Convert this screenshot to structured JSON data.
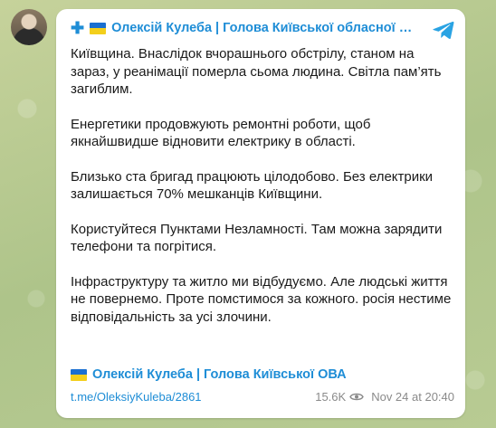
{
  "channel": {
    "title": "Олексій Кулеба | Голова Київської обласної …",
    "prefix_icon": "cross-icon",
    "flag_colors": [
      "#1a6fd1",
      "#f3cf1c"
    ]
  },
  "post": {
    "paragraphs": [
      "Київщина. Внаслідок вчорашнього обстрілу, станом на зараз, у реанімації померла сьома людина. Світла пам’ять загиблим.",
      "Енергетики продовжують ремонтні роботи, щоб якнайшвидше відновити електрику в області.",
      "Близько ста бригад працюють цілодобово. Без електрики залишається 70% мешканців Київщини.",
      "Користуйтеся Пунктами Незламності. Там можна зарядити телефони та погрітися.",
      "Інфраструктуру та житло ми відбудуємо. Але людські життя не повернемо. Проте помстимося за кожного. росія нестиме відповідальність за усі злочини."
    ],
    "signature": "Олексій Кулеба | Голова Київської ОВА"
  },
  "footer": {
    "link": "t.me/OleksiyKuleba/2861",
    "views": "15.6K",
    "timestamp": "Nov 24 at 20:40"
  },
  "colors": {
    "accent": "#1e8dd6",
    "text": "#1a1a1a",
    "meta": "#8a8a8a"
  }
}
